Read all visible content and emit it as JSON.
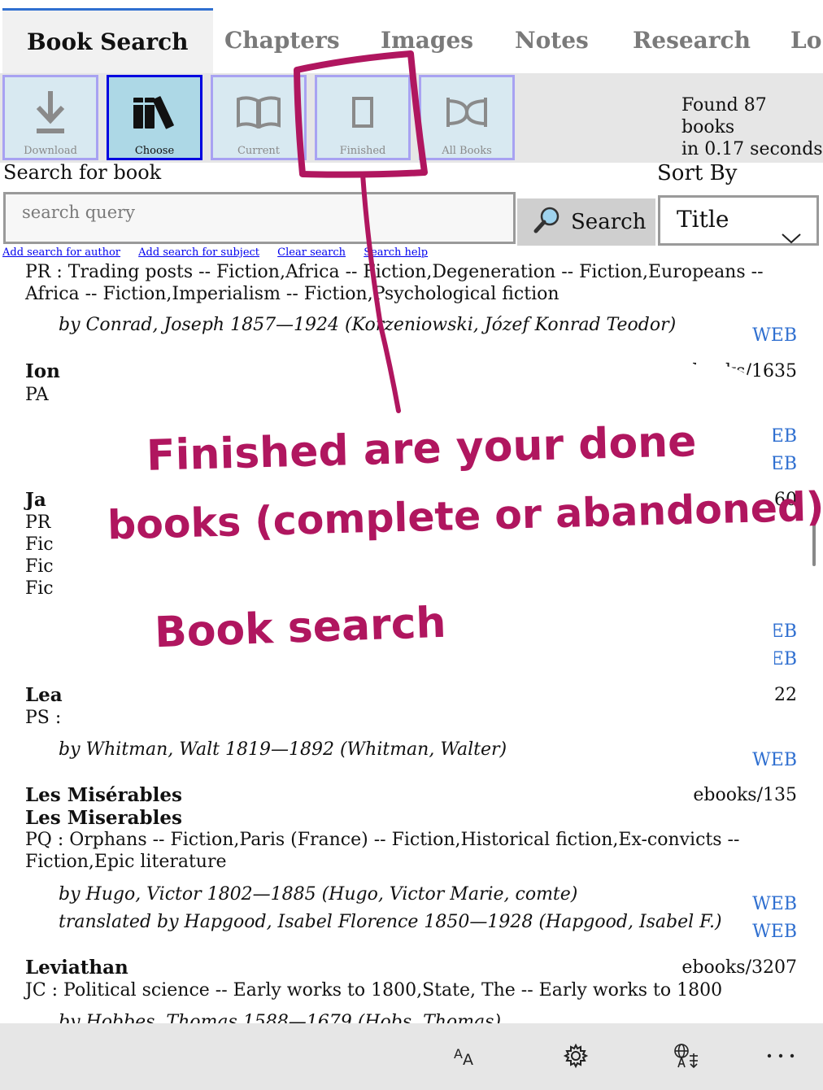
{
  "tabs": [
    {
      "label": "Book Search",
      "active": true
    },
    {
      "label": "Chapters"
    },
    {
      "label": "Images"
    },
    {
      "label": "Notes"
    },
    {
      "label": "Research"
    },
    {
      "label": "Lo"
    }
  ],
  "toolbar": {
    "buttons": [
      {
        "label": "Download",
        "icon": "download-icon"
      },
      {
        "label": "Choose",
        "icon": "books-icon",
        "selected": true
      },
      {
        "label": "Current",
        "icon": "open-book-icon"
      },
      {
        "label": "Finished",
        "icon": "closed-book-icon"
      },
      {
        "label": "All Books",
        "icon": "shuffle-icon"
      }
    ],
    "found_line1": "Found 87 books",
    "found_line2": "in 0.17 seconds"
  },
  "search": {
    "label": "Search for book",
    "placeholder": "search query",
    "button_label": "Search",
    "sort_label": "Sort By",
    "sort_value": "Title"
  },
  "links": [
    "Add search for author",
    "Add search for subject",
    "Clear search",
    "Search help"
  ],
  "results": [
    {
      "subject": "PR : Trading posts -- Fiction,Africa -- Fiction,Degeneration -- Fiction,Europeans -- Africa -- Fiction,Imperialism -- Fiction,Psychological fiction",
      "by": "by Conrad, Joseph 1857—1924 (Korzeniowski, Józef Konrad Teodor)",
      "web": "WEB"
    },
    {
      "title": "Ion",
      "ebook": "ebooks/1635",
      "subject": "PA : Homer. Iliad",
      "web": [
        "WEB",
        "WEB"
      ]
    },
    {
      "title": "Ja",
      "ebook": "60",
      "subject_lines": [
        "PR",
        "Fic",
        "Fic",
        "Fic"
      ],
      "web": [
        "EB",
        "EB"
      ]
    },
    {
      "title": "Lea",
      "ebook": "22",
      "subject": "PS :",
      "by": "by Whitman, Walt 1819—1892 (Whitman, Walter)",
      "web": "WEB"
    },
    {
      "title": "Les Misérables",
      "title2": "Les Miserables",
      "ebook": "ebooks/135",
      "subject": "PQ : Orphans -- Fiction,Paris (France) -- Fiction,Historical fiction,Ex-convicts -- Fiction,Epic literature",
      "by": "by Hugo, Victor 1802—1885 (Hugo, Victor Marie, comte)",
      "by2": "translated by Hapgood, Isabel Florence 1850—1928 (Hapgood, Isabel F.)",
      "web": [
        "WEB",
        "WEB"
      ]
    },
    {
      "title": "Leviathan",
      "ebook": "ebooks/3207",
      "subject": "JC : Political science -- Early works to 1800,State, The -- Early works to 1800",
      "by": "by Hobbes, Thomas 1588—1679 (Hobs, Thomas)"
    }
  ],
  "annotation": {
    "line1": "Finished are your done",
    "line2": "books (complete or abandoned)",
    "line3": "Book search",
    "color": "#b0165f"
  },
  "appbar": {
    "icons": [
      "font-size-icon",
      "gear-icon",
      "translate-icon",
      "more-icon"
    ]
  }
}
